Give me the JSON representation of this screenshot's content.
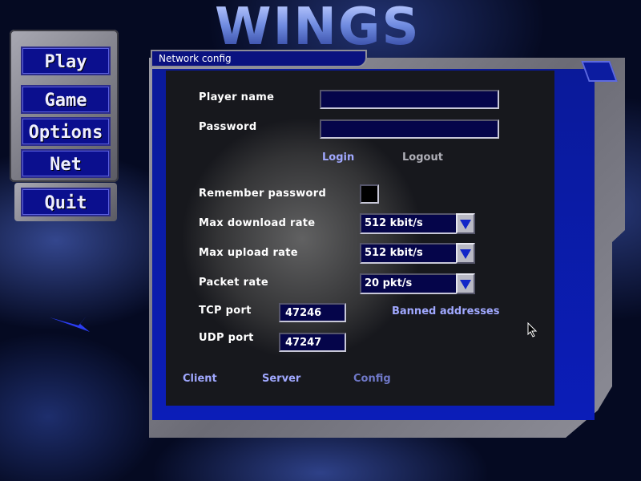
{
  "game_title": "WINGS",
  "menu": {
    "play": "Play",
    "game": "Game",
    "options": "Options",
    "net": "Net",
    "quit": "Quit"
  },
  "panel": {
    "tab_title": "Network config",
    "player_name_label": "Player name",
    "player_name_value": "",
    "password_label": "Password",
    "password_value": "",
    "login": "Login",
    "logout": "Logout",
    "remember_password_label": "Remember password",
    "remember_password_checked": false,
    "max_download_label": "Max download rate",
    "max_download_value": "512 kbit/s",
    "max_upload_label": "Max upload rate",
    "max_upload_value": "512 kbit/s",
    "packet_rate_label": "Packet rate",
    "packet_rate_value": "20 pkt/s",
    "tcp_port_label": "TCP port",
    "tcp_port_value": "47246",
    "udp_port_label": "UDP port",
    "udp_port_value": "47247",
    "banned_addresses": "Banned addresses",
    "tabs": {
      "client": "Client",
      "server": "Server",
      "config": "Config"
    }
  },
  "colors": {
    "link_active": "#a0a8ff",
    "link_disabled": "#b0b0b8",
    "link_current": "#6f78c8",
    "button_fill": "#0b0f8e"
  },
  "icons": {
    "dropdown": "triangle-down-icon",
    "cursor": "mouse-pointer-icon"
  }
}
